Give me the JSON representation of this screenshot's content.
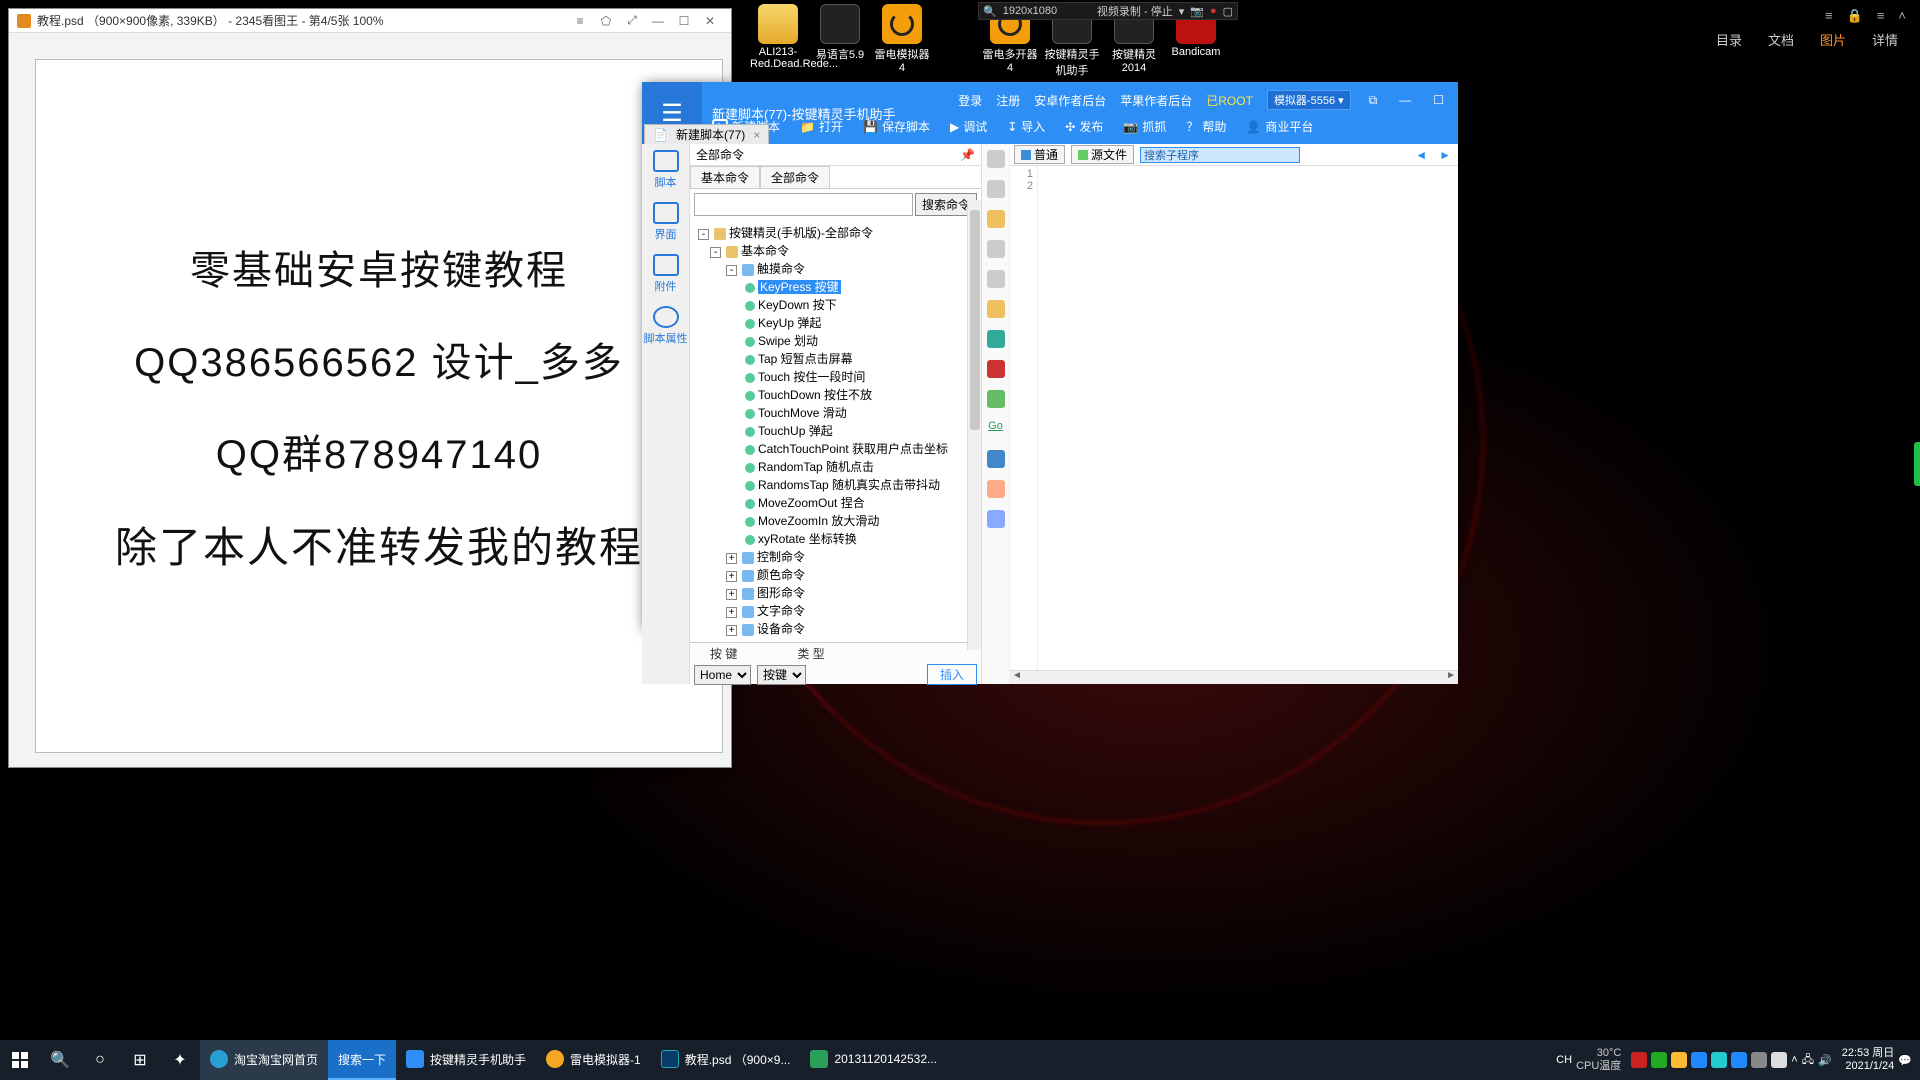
{
  "viewer": {
    "title": "教程.psd （900×900像素, 339KB） - 2345看图王 - 第4/5张 100%",
    "lines": {
      "l1": "零基础安卓按键教程",
      "l2": "QQ386566562  设计_多多",
      "l3": "QQ群878947140",
      "l4": "除了本人不准转发我的教程"
    }
  },
  "recorder": {
    "resolution": "1920x1080",
    "status": "视频录制 - 停止"
  },
  "mini_tabs": {
    "t1": "目录",
    "t2": "文档",
    "t3": "图片",
    "t4": "详情"
  },
  "desktop": {
    "i1": "ALI213-Red.Dead.Rede...",
    "i2": "易语言5.9",
    "i3": "雷电模拟器4",
    "i4": "雷电多开器4",
    "i5": "按键精灵手机助手",
    "i6": "按键精灵2014",
    "i7": "Bandicam"
  },
  "editor": {
    "title": "新建脚本(77)-按键精灵手机助手",
    "links": {
      "login": "登录",
      "register": "注册",
      "android": "安卓作者后台",
      "apple": "苹果作者后台",
      "root": "已ROOT",
      "device": "模拟器-5556"
    },
    "toolbar": {
      "new": "新建脚本",
      "open": "打开",
      "save": "保存脚本",
      "debug": "调试",
      "import": "导入",
      "publish": "发布",
      "capture": "抓抓",
      "help": "帮助",
      "biz": "商业平台"
    },
    "tab": "新建脚本(77)",
    "rail": {
      "script": "脚本",
      "ui": "界面",
      "attach": "附件",
      "prop": "脚本属性"
    },
    "cmd_head": "全部命令",
    "cmd_tabs": {
      "a": "基本命令",
      "b": "全部命令"
    },
    "search_btn": "搜索命令",
    "tree": {
      "root": "按键精灵(手机版)-全部命令",
      "basic": "基本命令",
      "touch": "触摸命令",
      "items": [
        "KeyPress 按键",
        "KeyDown 按下",
        "KeyUp 弹起",
        "Swipe 划动",
        "Tap 短暂点击屏幕",
        "Touch 按住一段时间",
        "TouchDown 按住不放",
        "TouchMove 滑动",
        "TouchUp 弹起",
        "CatchTouchPoint 获取用户点击坐标",
        "RandomTap 随机点击",
        "RandomsTap 随机真实点击带抖动",
        "MoveZoomOut 捏合",
        "MoveZoomIn 放大滑动",
        "xyRotate 坐标转换"
      ],
      "groups": [
        "控制命令",
        "颜色命令",
        "图形命令",
        "文字命令",
        "设备命令"
      ]
    },
    "params": {
      "key_label": "按 键",
      "type_label": "类 型",
      "key_val": "Home",
      "type_val": "按键",
      "insert": "插入"
    },
    "code": {
      "mode_normal": "普通",
      "mode_source": "源文件",
      "search_placeholder": "搜索子程序",
      "line1": "1",
      "line2": "2"
    }
  },
  "taskbar": {
    "items": {
      "ie": "淘宝淘宝网首页",
      "search": "搜索一下",
      "kb": "按键精灵手机助手",
      "ld": "雷电模拟器-1",
      "ps": "教程.psd （900×9...",
      "doc": "20131120142532..."
    },
    "ime": "CH",
    "temp1": "30°C",
    "temp2": "CPU温度",
    "time": "22:53 周日",
    "date": "2021/1/24"
  }
}
